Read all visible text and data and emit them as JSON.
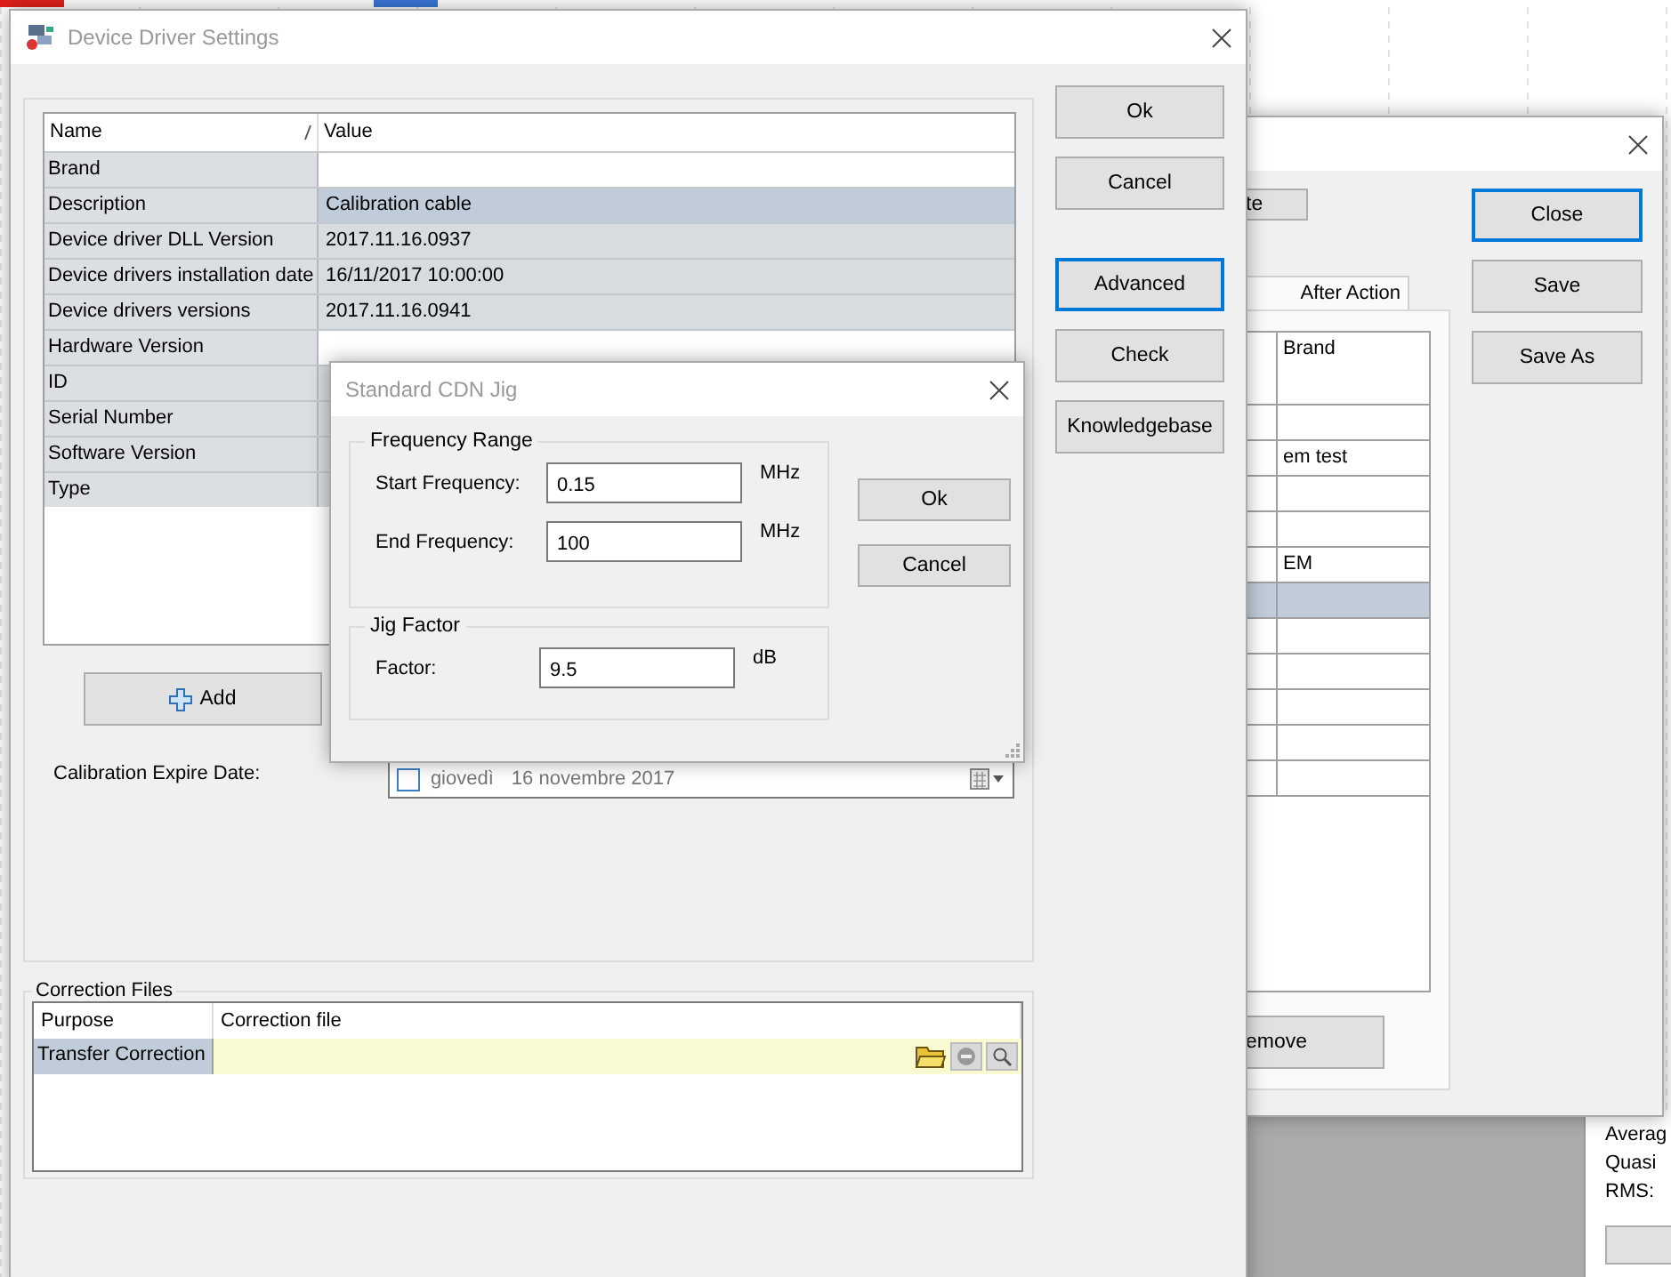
{
  "background": {
    "legend": [
      {
        "color": "#e0201c"
      },
      {
        "color": "#3a78d8"
      }
    ],
    "labels": [
      "Averag",
      "Quasi",
      "RMS:"
    ]
  },
  "back_window": {
    "top_button": "te",
    "tabs": [
      {
        "label": "After Action",
        "selected": true
      }
    ],
    "rows": [
      {
        "value": "Brand",
        "selected": false
      },
      {
        "selected": false
      },
      {
        "value": "em test",
        "selected": false
      },
      {
        "selected": false
      },
      {
        "selected": false
      },
      {
        "value": "EM",
        "selected": false
      },
      {
        "selected": true
      },
      {
        "selected": false
      },
      {
        "selected": false
      },
      {
        "selected": false
      },
      {
        "selected": false
      },
      {
        "selected": false
      }
    ],
    "buttons": [
      {
        "label": "Close",
        "focused": true
      },
      {
        "label": "Save",
        "focused": false
      },
      {
        "label": "Save As",
        "focused": false
      }
    ],
    "bottom_button": "emove"
  },
  "main_dialog": {
    "title": "Device Driver Settings",
    "grid": {
      "columns": [
        "Name",
        "Value"
      ],
      "rows": [
        {
          "name": "Brand",
          "selected": false,
          "readonly": false
        },
        {
          "name": "Description",
          "value": "Calibration cable",
          "selected": true
        },
        {
          "name": "Device driver DLL Version",
          "value": "2017.11.16.0937",
          "selected": false,
          "readonly": true
        },
        {
          "name": "Device drivers installation date",
          "value": "16/11/2017 10:00:00",
          "selected": false,
          "readonly": true
        },
        {
          "name": "Device drivers versions",
          "value": "2017.11.16.0941",
          "selected": false,
          "readonly": true
        },
        {
          "name": "Hardware Version",
          "selected": false,
          "readonly": false
        },
        {
          "name": "ID",
          "selected": false,
          "readonly": true
        },
        {
          "name": "Serial Number",
          "selected": false,
          "readonly": true
        },
        {
          "name": "Software Version",
          "selected": false,
          "readonly": true
        },
        {
          "name": "Type",
          "selected": false,
          "readonly": true
        }
      ]
    },
    "buttons": [
      {
        "label": "Ok",
        "focused": false
      },
      {
        "label": "Cancel",
        "focused": false
      }
    ],
    "tool_buttons": [
      {
        "label": "Advanced",
        "focused": true
      },
      {
        "label": "Check",
        "focused": false
      },
      {
        "label": "Knowledgebase",
        "focused": false
      }
    ],
    "add_button": "Add",
    "expire": {
      "label": "Calibration Expire Date:",
      "checked": false,
      "day": "giovedì",
      "date": "16 novembre 2017"
    },
    "correction": {
      "title": "Correction Files",
      "columns": [
        "Purpose",
        "Correction file"
      ],
      "rows": [
        {
          "purpose": "Transfer Correction",
          "selected": true
        }
      ]
    }
  },
  "jig_dialog": {
    "title": "Standard CDN Jig",
    "groups": [
      {
        "title": "Frequency Range",
        "fields": [
          {
            "label": "Start Frequency:",
            "value": "0.15",
            "unit": "MHz"
          },
          {
            "label": "End Frequency:",
            "value": "100",
            "unit": "MHz"
          }
        ]
      },
      {
        "title": "Jig Factor",
        "fields": [
          {
            "label": "Factor:",
            "value": "9.5",
            "unit": "dB"
          }
        ]
      }
    ],
    "buttons": [
      "Ok",
      "Cancel"
    ]
  }
}
